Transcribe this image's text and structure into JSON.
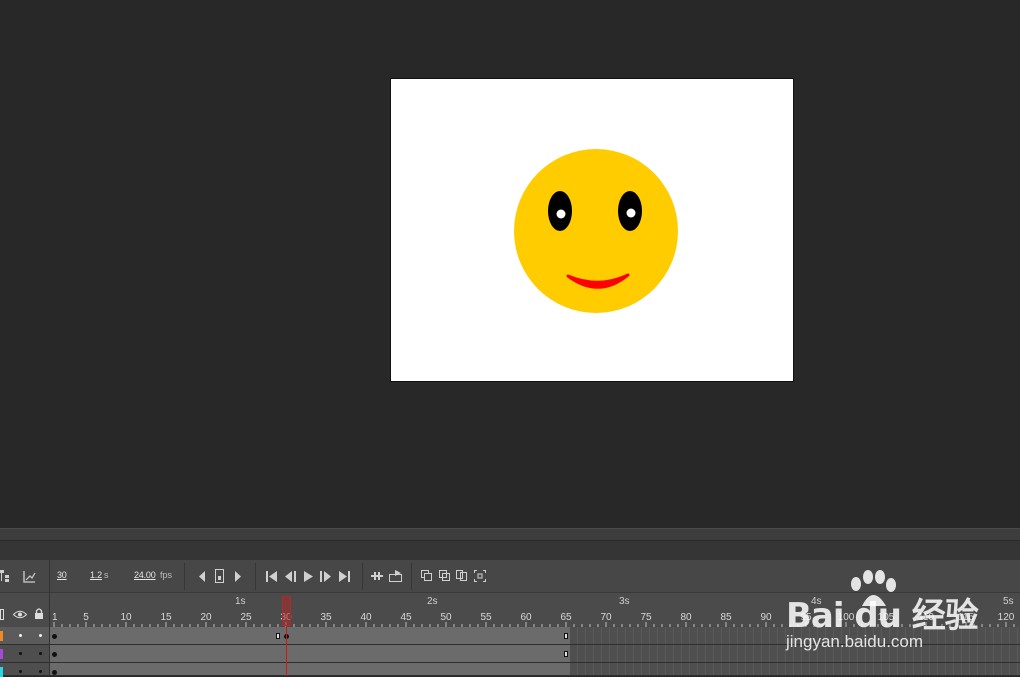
{
  "stage": {
    "background": "#ffffff",
    "face_color": "#ffcc00",
    "eye_color": "#000000",
    "pupil_color": "#ffffff",
    "mouth_color": "#ff0000"
  },
  "toolbar": {
    "current_frame": "30",
    "elapsed_time": "1.2",
    "elapsed_unit": "s",
    "fps_value": "24.00",
    "fps_unit": "fps",
    "icons": [
      "layer-hierarchy-icon",
      "graph-icon",
      "step-back-icon",
      "center-frame-icon",
      "step-forward-icon",
      "first-frame-icon",
      "previous-frame-icon",
      "play-icon",
      "next-frame-icon",
      "last-frame-icon",
      "loop-icon",
      "edit-multiple-frames-icon",
      "onion-skin-icon",
      "onion-skin-outlines-icon",
      "onion-range-icon",
      "onion-settings-icon"
    ]
  },
  "ruler": {
    "seconds": [
      "1s",
      "2s",
      "3s",
      "4s",
      "5s"
    ],
    "frames": [
      "1",
      "5",
      "10",
      "15",
      "20",
      "25",
      "30",
      "35",
      "40",
      "45",
      "50",
      "55",
      "60",
      "65",
      "70",
      "75",
      "80",
      "85",
      "90",
      "95",
      "100",
      "105",
      "110",
      "115",
      "120"
    ]
  },
  "layers": [
    {
      "color": "#f08a24",
      "selected": true
    },
    {
      "color": "#a24bd6",
      "selected": false
    },
    {
      "color": "#2ad4e0",
      "selected": false
    }
  ],
  "playhead_frame": 30,
  "watermark": {
    "brand": "Bai du 经验",
    "url": "jingyan.baidu.com"
  }
}
